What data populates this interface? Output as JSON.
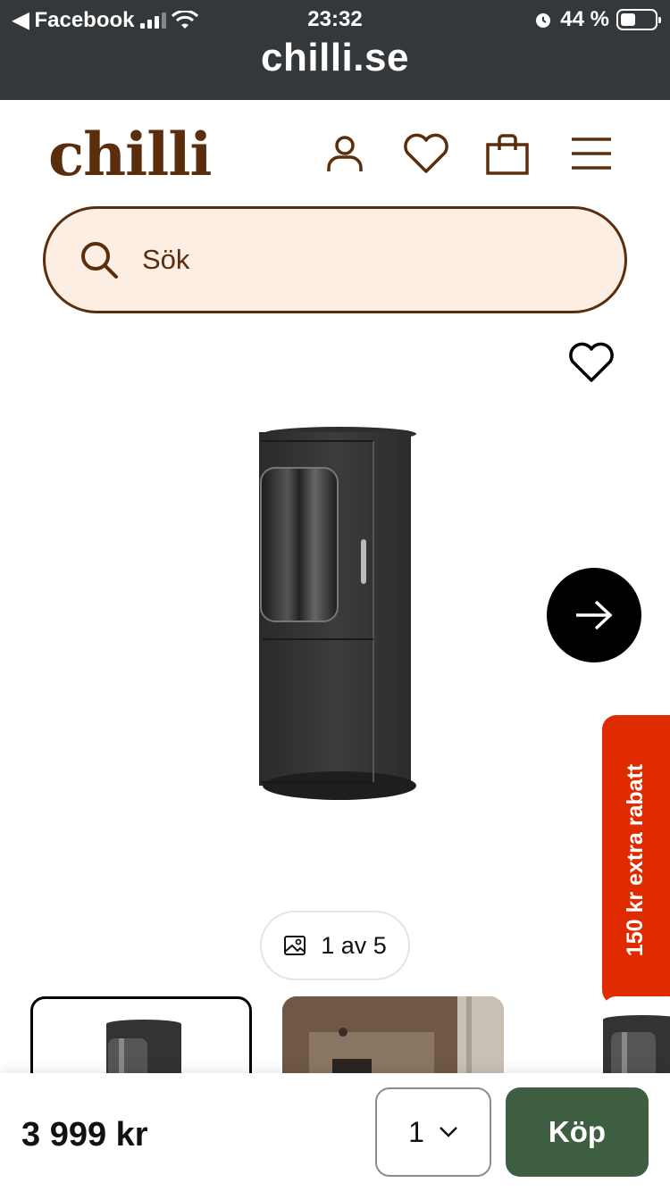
{
  "status_bar": {
    "back_app": "Facebook",
    "time": "23:32",
    "battery_percent": "44 %",
    "battery_level": 0.44,
    "url": "chilli.se"
  },
  "header": {
    "logo": "chilli",
    "icons": [
      "account-icon",
      "heart-icon",
      "shopping-bag-icon",
      "menu-icon"
    ]
  },
  "search": {
    "placeholder": "Sök"
  },
  "gallery": {
    "counter": "1 av 5",
    "current": 1,
    "total": 5
  },
  "promo_tab": {
    "label": "150 kr extra rabatt"
  },
  "purchase": {
    "price": "3 999 kr",
    "quantity": "1",
    "buy_label": "Köp"
  },
  "colors": {
    "brand_brown": "#5a2e0c",
    "search_bg": "#fdeee3",
    "buy_green": "#3e5e42",
    "promo_red": "#e02a00",
    "status_bar": "#34383a"
  }
}
